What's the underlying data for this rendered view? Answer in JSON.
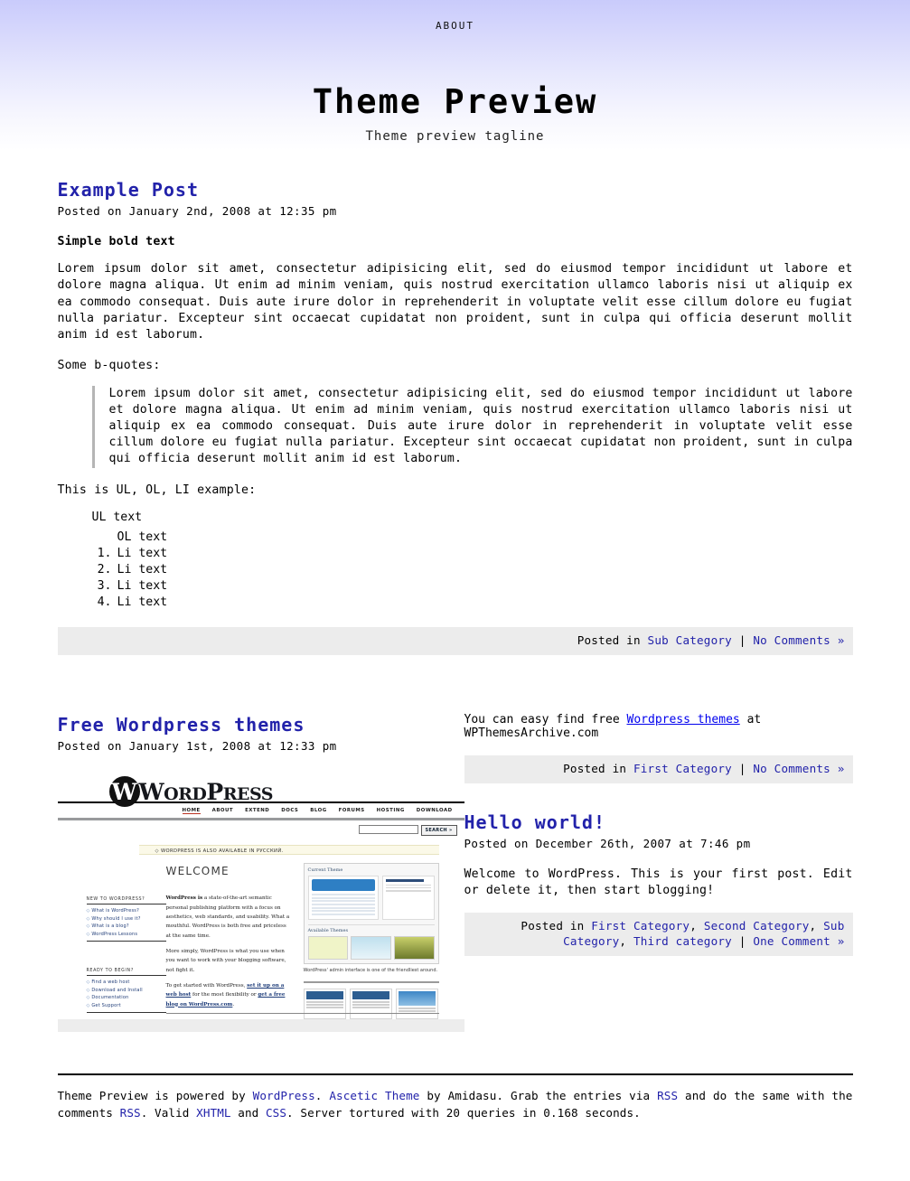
{
  "header": {
    "nav": [
      {
        "label": "ABOUT"
      }
    ],
    "title": "Theme Preview",
    "tagline": "Theme preview tagline"
  },
  "posts": [
    {
      "title": "Example Post",
      "date": "Posted on January 2nd, 2008 at 12:35 pm",
      "bold_line": "Simple bold text",
      "body": "Lorem ipsum dolor sit amet, consectetur adipisicing elit, sed do eiusmod tempor incididunt ut labore et dolore magna aliqua. Ut enim ad minim veniam, quis nostrud exercitation ullamco laboris nisi ut aliquip ex ea commodo consequat. Duis aute irure dolor in reprehenderit in voluptate velit esse cillum dolore eu fugiat nulla pariatur. Excepteur sint occaecat cupidatat non proident, sunt in culpa qui officia deserunt mollit anim id est laborum.",
      "bquote_intro": "Some b-quotes:",
      "blockquote": "Lorem ipsum dolor sit amet, consectetur adipisicing elit, sed do eiusmod tempor incididunt ut labore et dolore magna aliqua. Ut enim ad minim veniam, quis nostrud exercitation ullamco laboris nisi ut aliquip ex ea commodo consequat. Duis aute irure dolor in reprehenderit in voluptate velit esse cillum dolore eu fugiat nulla pariatur. Excepteur sint occaecat cupidatat non proident, sunt in culpa qui officia deserunt mollit anim id est laborum.",
      "list_intro": "This is UL, OL, LI example:",
      "ul_items": [
        "UL text"
      ],
      "ol_first": "OL text",
      "ol_items": [
        "Li text",
        "Li text",
        "Li text",
        "Li text"
      ],
      "meta": {
        "posted_in": "Posted in",
        "categories": [
          "Sub Category"
        ],
        "separator": "|",
        "comments": "No Comments »"
      }
    },
    {
      "title": "Free Wordpress themes",
      "date": "Posted on January 1st, 2008 at 12:33 pm",
      "body_prefix": "You can easy find free ",
      "body_link": "Wordpress themes",
      "body_suffix": " at WPThemesArchive.com",
      "meta": {
        "posted_in": "Posted in",
        "categories": [
          "First Category"
        ],
        "separator": "|",
        "comments": "No Comments »"
      }
    },
    {
      "title": "Hello world!",
      "date": "Posted on December 26th, 2007 at 7:46 pm",
      "body": "Welcome to WordPress. This is your first post. Edit or delete it, then start blogging!",
      "meta": {
        "posted_in": "Posted in",
        "categories": [
          "First Category",
          "Second Category",
          "Sub Category",
          "Third category"
        ],
        "separator": "|",
        "comments": "One Comment »"
      }
    }
  ],
  "wordpress_screenshot": {
    "logo_letter": "W",
    "wordmark_w": "W",
    "wordmark_ord": "ORD",
    "wordmark_p": "P",
    "wordmark_ress": "RESS",
    "nav": [
      "HOME",
      "ABOUT",
      "EXTEND",
      "DOCS",
      "BLOG",
      "FORUMS",
      "HOSTING",
      "DOWNLOAD"
    ],
    "search_button": "SEARCH »",
    "notice": "◇ WORDPRESS IS ALSO AVAILABLE IN РУССКИЙ.",
    "welcome": "WELCOME",
    "sidebar_one_title": "NEW TO WORDPRESS?",
    "sidebar_one_links": [
      "What is WordPress?",
      "Why should I use it?",
      "What is a blog?",
      "WordPress Lessons"
    ],
    "sidebar_two_title": "READY TO BEGIN?",
    "sidebar_two_links": [
      "Find a web host",
      "Download and Install",
      "Documentation",
      "Get Support"
    ],
    "para_one_bold": "WordPress is",
    "para_one": " a state-of-the-art semantic personal publishing platform with a focus on aesthetics, web standards, and usability. What a mouthful. WordPress is both free and priceless at the same time.",
    "para_two": "More simply, WordPress is what you use when you want to work with your blogging software, not fight it.",
    "para_three_a": "To get started with WordPress, ",
    "para_three_link1": "set it up on a web host",
    "para_three_b": " for the most flexibility or ",
    "para_three_link2": "get a free blog on WordPress.com",
    "para_three_c": ".",
    "panel_title": "Current Theme",
    "panel_title2": "Available Themes",
    "panel_caption": "WordPress' admin interface is one of the friendliest around."
  },
  "footer": {
    "t1": "Theme Preview is powered by ",
    "l1": "WordPress",
    "t2": ". ",
    "l2": "Ascetic Theme",
    "t3": " by Amidasu. Grab the entries via ",
    "l3": "RSS",
    "t4": " and do the same with the comments ",
    "l4": "RSS",
    "t5": ". Valid ",
    "l5": "XHTML",
    "t6": " and ",
    "l6": "CSS",
    "t7": ". Server tortured with 20 queries in 0.168 seconds."
  },
  "colors": {
    "link": "#2222aa",
    "meta_bg": "#ececec",
    "header_gradient_top": "#c9cbfb",
    "blockquote_border": "#b5b5b5"
  }
}
